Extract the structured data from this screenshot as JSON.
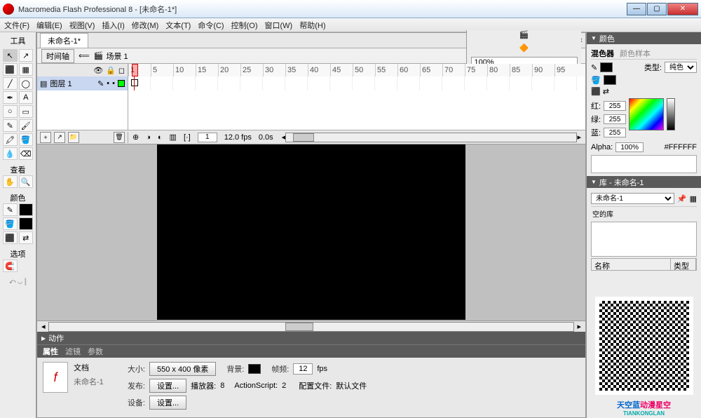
{
  "window": {
    "title": "Macromedia Flash Professional 8 - [未命名-1*]"
  },
  "menu": [
    "文件(F)",
    "编辑(E)",
    "视图(V)",
    "插入(I)",
    "修改(M)",
    "文本(T)",
    "命令(C)",
    "控制(O)",
    "窗口(W)",
    "帮助(H)"
  ],
  "doc": {
    "tab": "未命名-1*",
    "timeline_btn": "时间轴",
    "scene": "场景 1",
    "zoom": "100%"
  },
  "tools_header": "工具",
  "view_header": "查看",
  "colors_header": "颜色",
  "options_header": "选项",
  "timeline": {
    "layer": "图层 1",
    "ticks": [
      "1",
      "5",
      "10",
      "15",
      "20",
      "25",
      "30",
      "35",
      "40",
      "45",
      "50",
      "55",
      "60",
      "65",
      "70",
      "75",
      "80",
      "85",
      "90",
      "95"
    ],
    "current_frame": "1",
    "fps": "12.0 fps",
    "time": "0.0s"
  },
  "actions_title": "动作",
  "props": {
    "tabs": [
      "属性",
      "滤镜",
      "参数"
    ],
    "doc_type": "文档",
    "doc_name": "未命名-1",
    "size_lbl": "大小:",
    "size_val": "550 x 400 像素",
    "bg_lbl": "背景:",
    "frate_lbl": "帧频:",
    "frate_val": "12",
    "fps_lbl": "fps",
    "publish_lbl": "发布:",
    "settings_btn": "设置...",
    "player_lbl": "播放器:",
    "player_val": "8",
    "as_lbl": "ActionScript:",
    "as_val": "2",
    "profile_lbl": "配置文件:",
    "profile_val": "默认文件",
    "device_lbl": "设备:"
  },
  "color_panel": {
    "title": "颜色",
    "tab_mixer": "混色器",
    "tab_swatch": "颜色样本",
    "type_lbl": "类型:",
    "type_val": "纯色",
    "r_lbl": "红:",
    "r_val": "255",
    "g_lbl": "绿:",
    "g_val": "255",
    "b_lbl": "蓝:",
    "b_val": "255",
    "alpha_lbl": "Alpha:",
    "alpha_val": "100%",
    "hex": "#FFFFFF"
  },
  "library": {
    "title": "库 - 未命名-1",
    "doc": "未命名-1",
    "empty": "空的库",
    "col_name": "名称",
    "col_type": "类型"
  },
  "brand": {
    "name": "天空蓝",
    "sub": "动漫星空",
    "en": "TIANKONGLAN"
  }
}
